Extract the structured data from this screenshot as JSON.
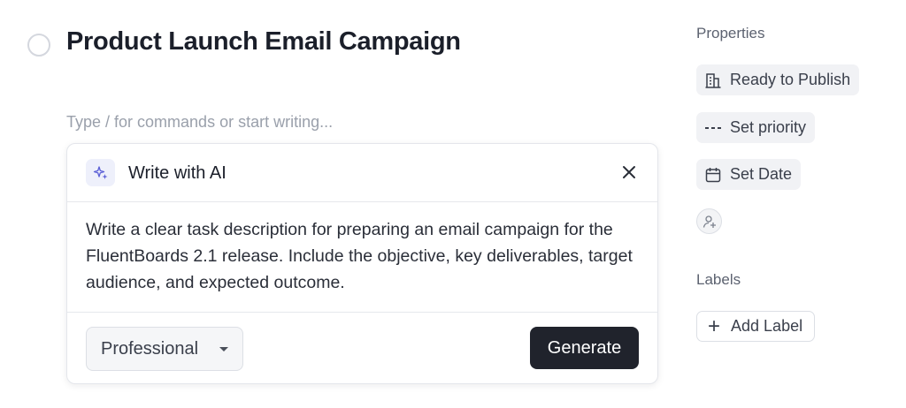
{
  "task": {
    "title": "Product Launch Email Campaign",
    "status_icon": "empty-circle-icon"
  },
  "editor": {
    "placeholder": "Type / for commands or start writing..."
  },
  "ai_panel": {
    "title": "Write with AI",
    "icon": "sparkle-icon",
    "close_icon": "close-icon",
    "prompt": "Write a clear task description for preparing an email campaign for the FluentBoards 2.1 release. Include the objective, key deliverables, target audience, and expected outcome.",
    "tone": "Professional",
    "generate_label": "Generate",
    "accent_color": "#5b5fd6"
  },
  "properties": {
    "heading": "Properties",
    "status": {
      "label": "Ready to Publish",
      "icon": "building-icon"
    },
    "priority": {
      "label": "Set priority",
      "icon": "dashes-icon"
    },
    "date": {
      "label": "Set Date",
      "icon": "calendar-icon"
    },
    "assignee_icon": "add-user-icon"
  },
  "labels": {
    "heading": "Labels",
    "add_label": "Add Label"
  }
}
